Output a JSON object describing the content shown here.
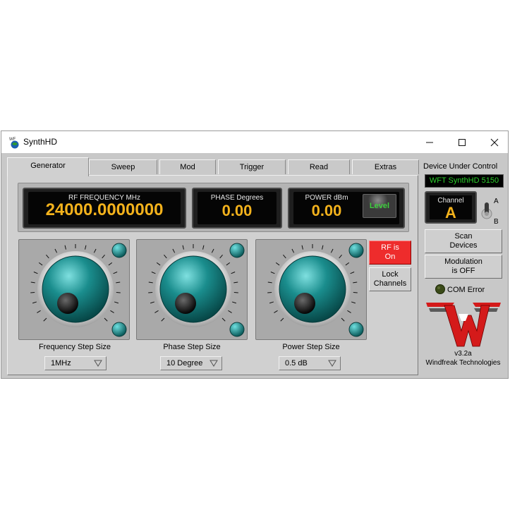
{
  "window": {
    "title": "SynthHD",
    "icon_text": "WF"
  },
  "tabs": [
    {
      "label": "Generator",
      "active": true
    },
    {
      "label": "Sweep",
      "active": false
    },
    {
      "label": "Mod",
      "active": false
    },
    {
      "label": "Trigger",
      "active": false
    },
    {
      "label": "Read",
      "active": false
    },
    {
      "label": "Extras",
      "active": false
    }
  ],
  "displays": {
    "frequency": {
      "label": "RF  FREQUENCY MHz",
      "value": "24000.0000000"
    },
    "phase": {
      "label": "PHASE Degrees",
      "value": "0.00"
    },
    "power": {
      "label": "POWER dBm",
      "value": "0.00",
      "level_button": "Level"
    }
  },
  "knobs": [
    {
      "label": "Frequency Step Size",
      "selected": "1MHz"
    },
    {
      "label": "Phase Step Size",
      "selected": "10 Degree"
    },
    {
      "label": "Power Step Size",
      "selected": "0.5 dB"
    }
  ],
  "buttons": {
    "rf": "RF is\nOn",
    "lock": "Lock\nChannels",
    "scan": "Scan\nDevices",
    "modulation": "Modulation\nis OFF"
  },
  "side": {
    "header": "Device Under Control",
    "device": "WFT SynthHD 5150",
    "channel_label": "Channel",
    "channel_value": "A",
    "switch_a": "A",
    "switch_b": "B",
    "com_status": "COM Error",
    "version": "v3.2a",
    "company": "Windfreak Technologies"
  },
  "colors": {
    "teal": "#1a8d8d",
    "lcd_amber": "#f3b21c",
    "rf_red": "#ee2c2c",
    "status_green": "#2bd12b"
  }
}
